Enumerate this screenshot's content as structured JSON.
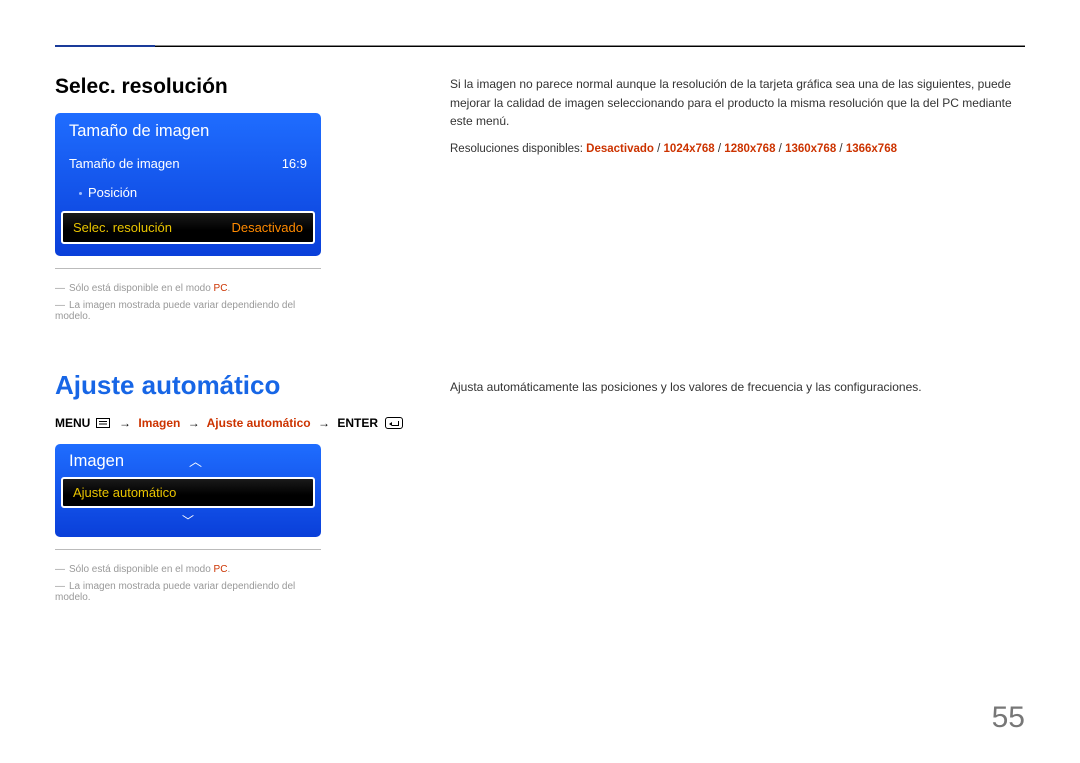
{
  "page_number": "55",
  "section1": {
    "title": "Selec. resolución",
    "osd": {
      "header": "Tamaño de imagen",
      "row1_label": "Tamaño de imagen",
      "row1_value": "16:9",
      "row2_label": "Posición",
      "hl_label": "Selec. resolución",
      "hl_value": "Desactivado"
    },
    "footnotes": {
      "fn1_pre": "Sólo está disponible en el modo ",
      "fn1_hl": "PC",
      "fn1_post": ".",
      "fn2": "La imagen mostrada puede variar dependiendo del modelo."
    },
    "right": {
      "para": "Si la imagen no parece normal aunque la resolución de la tarjeta gráfica sea una de las siguientes, puede mejorar la calidad de imagen seleccionando para el producto la misma resolución que la del PC mediante este menú.",
      "resline_prefix": "Resoluciones disponibles: ",
      "options": [
        "Desactivado",
        "1024x768",
        "1280x768",
        "1360x768",
        "1366x768"
      ]
    }
  },
  "section2": {
    "title": "Ajuste automático",
    "path": {
      "p0": "MENU",
      "p1": "Imagen",
      "p2": "Ajuste automático",
      "p3": "ENTER"
    },
    "osd": {
      "header": "Imagen",
      "hl_label": "Ajuste automático"
    },
    "footnotes": {
      "fn1_pre": "Sólo está disponible en el modo ",
      "fn1_hl": "PC",
      "fn1_post": ".",
      "fn2": "La imagen mostrada puede variar dependiendo del modelo."
    },
    "right": {
      "para": "Ajusta automáticamente las posiciones y los valores de frecuencia y las configuraciones."
    }
  }
}
